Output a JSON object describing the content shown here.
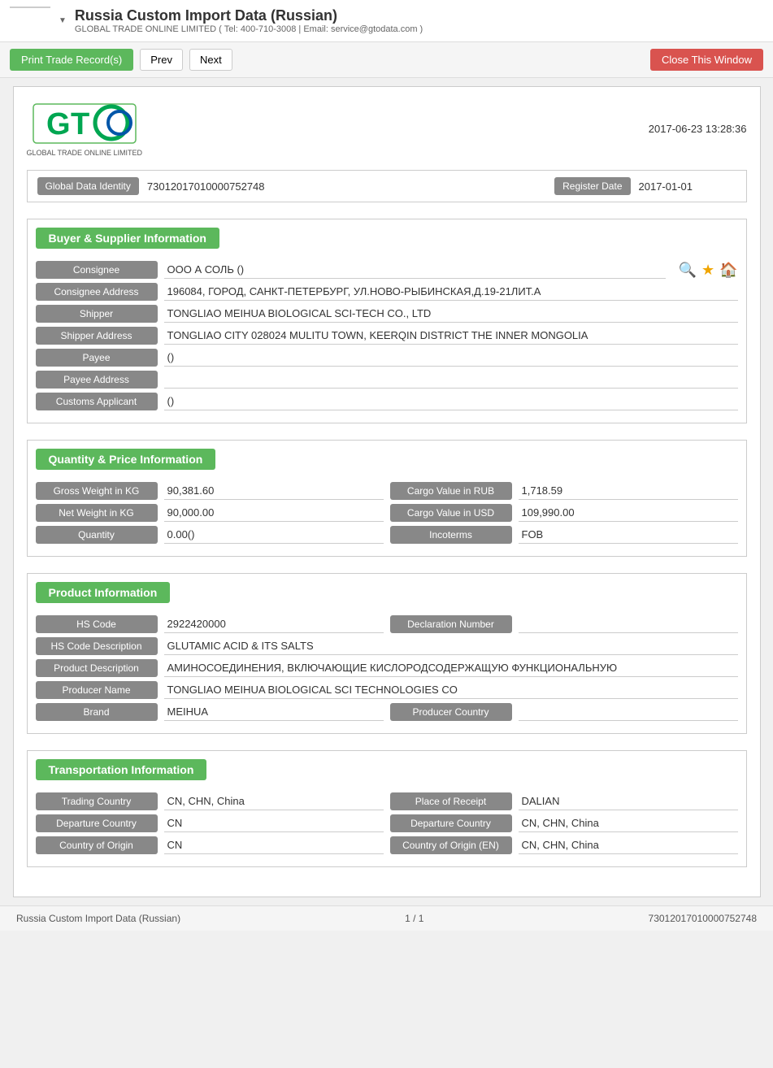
{
  "header": {
    "title": "Russia Custom Import Data (Russian)",
    "subtitle": "GLOBAL TRADE ONLINE LIMITED ( Tel: 400-710-3008 | Email: service@gtodata.com )",
    "dropdown_arrow": "▼"
  },
  "toolbar": {
    "print_label": "Print Trade Record(s)",
    "prev_label": "Prev",
    "next_label": "Next",
    "close_label": "Close This Window"
  },
  "logo": {
    "timestamp": "2017-06-23 13:28:36",
    "tagline": "GLOBAL TRADE ONLINE LIMITED"
  },
  "identity": {
    "label": "Global Data Identity",
    "value": "73012017010000752748",
    "date_label": "Register Date",
    "date_value": "2017-01-01"
  },
  "buyer_supplier": {
    "section_title": "Buyer & Supplier Information",
    "consignee_label": "Consignee",
    "consignee_value": "ООО А СОЛЬ ()",
    "consignee_address_label": "Consignee Address",
    "consignee_address_value": "196084, ГОРОД, САНКТ-ПЕТЕРБУРГ, УЛ.НОВО-РЫБИНСКАЯ,Д.19-21ЛИТ.А",
    "shipper_label": "Shipper",
    "shipper_value": "TONGLIAO MEIHUA BIOLOGICAL SCI-TECH CO., LTD",
    "shipper_address_label": "Shipper Address",
    "shipper_address_value": "TONGLIAO CITY 028024 MULITU TOWN, KEERQIN DISTRICT THE INNER MONGOLIA",
    "payee_label": "Payee",
    "payee_value": "()",
    "payee_address_label": "Payee Address",
    "payee_address_value": "",
    "customs_applicant_label": "Customs Applicant",
    "customs_applicant_value": "()"
  },
  "quantity_price": {
    "section_title": "Quantity & Price Information",
    "gross_weight_label": "Gross Weight in KG",
    "gross_weight_value": "90,381.60",
    "cargo_rub_label": "Cargo Value in RUB",
    "cargo_rub_value": "1,718.59",
    "net_weight_label": "Net Weight in KG",
    "net_weight_value": "90,000.00",
    "cargo_usd_label": "Cargo Value in USD",
    "cargo_usd_value": "109,990.00",
    "quantity_label": "Quantity",
    "quantity_value": "0.00()",
    "incoterms_label": "Incoterms",
    "incoterms_value": "FOB"
  },
  "product": {
    "section_title": "Product Information",
    "hs_code_label": "HS Code",
    "hs_code_value": "2922420000",
    "declaration_label": "Declaration Number",
    "declaration_value": "",
    "hs_desc_label": "HS Code Description",
    "hs_desc_value": "GLUTAMIC ACID & ITS SALTS",
    "prod_desc_label": "Product Description",
    "prod_desc_value": "АМИНОСОЕДИНЕНИЯ, ВКЛЮЧАЮЩИЕ КИСЛОРОДСОДЕРЖАЩУЮ ФУНКЦИОНАЛЬНУЮ",
    "producer_name_label": "Producer Name",
    "producer_name_value": "TONGLIAO MEIHUA BIOLOGICAL SCI TECHNOLOGIES CO",
    "brand_label": "Brand",
    "brand_value": "MEIHUA",
    "producer_country_label": "Producer Country",
    "producer_country_value": ""
  },
  "transportation": {
    "section_title": "Transportation Information",
    "trading_country_label": "Trading Country",
    "trading_country_value": "CN, CHN, China",
    "place_of_receipt_label": "Place of Receipt",
    "place_of_receipt_value": "DALIAN",
    "departure_country_label": "Departure Country",
    "departure_country_value": "CN",
    "departure_country2_label": "Departure Country",
    "departure_country2_value": "CN, CHN, China",
    "country_of_origin_label": "Country of Origin",
    "country_of_origin_value": "CN",
    "country_of_origin_en_label": "Country of Origin (EN)",
    "country_of_origin_en_value": "CN, CHN, China"
  },
  "footer": {
    "title": "Russia Custom Import Data (Russian)",
    "page": "1 / 1",
    "id": "73012017010000752748"
  }
}
